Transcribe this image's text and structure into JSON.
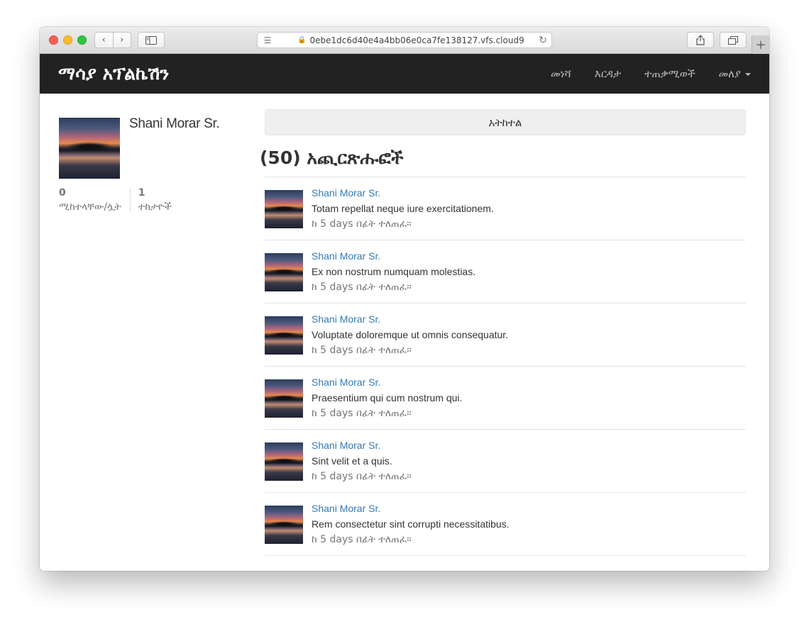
{
  "browser": {
    "url": "0ebe1dc6d40e4a4bb06e0ca7fe138127.vfs.cloud9",
    "icons": {
      "back": "chevron-left-icon",
      "forward": "chevron-right-icon",
      "sidebar": "sidebar-icon",
      "reader": "reader-icon",
      "lock": "lock-icon",
      "reload": "reload-icon",
      "share": "share-icon",
      "tabs": "tabs-icon",
      "new_tab": "plus-icon"
    }
  },
  "navbar": {
    "brand": "ማሳያ አፕልኬሽን",
    "links": [
      {
        "label": "መነሻ"
      },
      {
        "label": "እርዳታ"
      },
      {
        "label": "ተጠቃሚወች"
      },
      {
        "label": "መለያ"
      }
    ]
  },
  "profile": {
    "name": "Shani Morar Sr.",
    "stats": [
      {
        "value": "0",
        "label": "ሚከተላቸው/ሏት"
      },
      {
        "value": "1",
        "label": "ተከታዮች"
      }
    ]
  },
  "main": {
    "follow_label": "አትከተል",
    "heading": "(50) አጪርጽሑፎች",
    "posts": [
      {
        "author": "Shani Morar Sr.",
        "body": "Totam repellat neque iure exercitationem.",
        "time": "ከ 5 days በፊት ተለጠፈ።"
      },
      {
        "author": "Shani Morar Sr.",
        "body": "Ex non nostrum numquam molestias.",
        "time": "ከ 5 days በፊት ተለጠፈ።"
      },
      {
        "author": "Shani Morar Sr.",
        "body": "Voluptate doloremque ut omnis consequatur.",
        "time": "ከ 5 days በፊት ተለጠፈ።"
      },
      {
        "author": "Shani Morar Sr.",
        "body": "Praesentium qui cum nostrum qui.",
        "time": "ከ 5 days በፊት ተለጠፈ።"
      },
      {
        "author": "Shani Morar Sr.",
        "body": "Sint velit et a quis.",
        "time": "ከ 5 days በፊት ተለጠፈ።"
      },
      {
        "author": "Shani Morar Sr.",
        "body": "Rem consectetur sint corrupti necessitatibus.",
        "time": "ከ 5 days በፊት ተለጠፈ።"
      }
    ]
  },
  "colors": {
    "navbar_bg": "#222222",
    "link": "#337ab7",
    "muted": "#777777"
  }
}
